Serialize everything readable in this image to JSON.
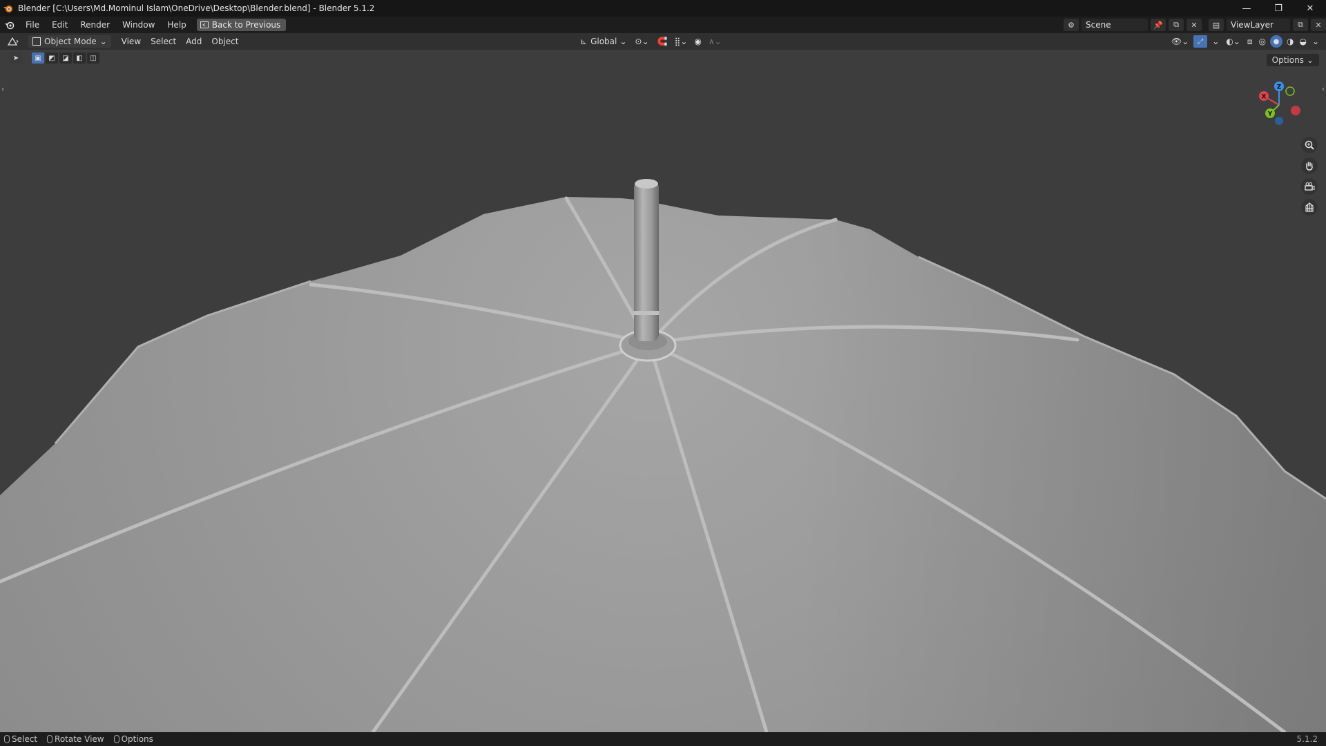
{
  "window": {
    "title": "Blender [C:\\Users\\Md.Mominul Islam\\OneDrive\\Desktop\\Blender.blend] - Blender 5.1.2",
    "minimize": "—",
    "maximize": "❐",
    "close": "✕"
  },
  "menu": {
    "items": [
      "File",
      "Edit",
      "Render",
      "Window",
      "Help"
    ],
    "back_label": "Back to Previous",
    "scene": "Scene",
    "view_layer": "ViewLayer"
  },
  "viewport_header": {
    "mode": "Object Mode",
    "menus": [
      "View",
      "Select",
      "Add",
      "Object"
    ],
    "transform_orientation": "Global",
    "options_label": "Options"
  },
  "gizmo": {
    "x": "X",
    "y": "Y",
    "z": "Z"
  },
  "colors": {
    "accent": "#4772b3",
    "axis_x": "#e0434c",
    "axis_y": "#7fbf23",
    "axis_z": "#3d8fe6"
  },
  "icons": {
    "navigation": [
      "zoom-icon",
      "pan-hand-icon",
      "camera-view-icon",
      "ortho-grid-icon"
    ]
  },
  "status": {
    "select": "Select",
    "rotate": "Rotate View",
    "options": "Options",
    "version": "5.1.2"
  }
}
